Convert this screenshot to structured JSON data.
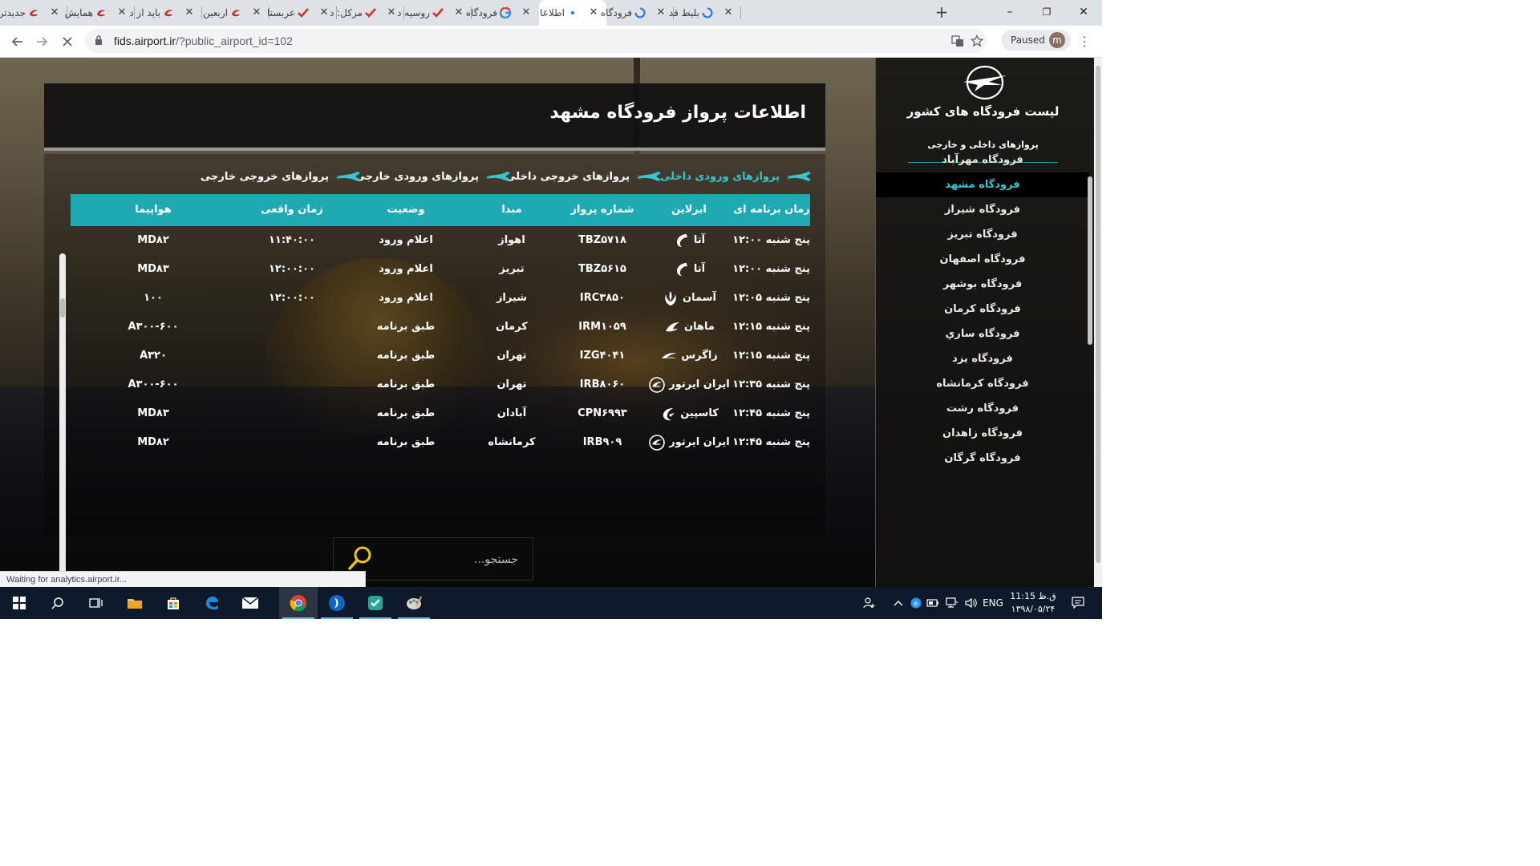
{
  "browser": {
    "tabs": [
      {
        "title": "جدیدتر",
        "favicon": "red-logo-icon",
        "active": false
      },
      {
        "title": "همایش",
        "favicon": "red-logo-icon",
        "active": false
      },
      {
        "title": "باید از د",
        "favicon": "red-logo-icon",
        "active": false
      },
      {
        "title": "اربعین",
        "favicon": "red-logo-icon",
        "active": false
      },
      {
        "title": "عربستا",
        "favicon": "red-check-icon",
        "active": false
      },
      {
        "title": "مرکل: د",
        "favicon": "red-check-icon",
        "active": false
      },
      {
        "title": "روسیه د",
        "favicon": "red-check-icon",
        "active": false
      },
      {
        "title": "فرودگاه",
        "favicon": "google-icon",
        "active": false
      },
      {
        "title": "اطلاعا",
        "favicon": "loading-dot-icon",
        "active": true
      },
      {
        "title": "فرودگاه",
        "favicon": "loading-spinner-icon",
        "active": false
      },
      {
        "title": "بلیط قد",
        "favicon": "loading-spinner-icon",
        "active": false
      }
    ],
    "new_tab_label": "+",
    "window_controls": {
      "minimize": "–",
      "maximize": "❐",
      "close": "✕"
    },
    "url_host": "fids.airport.ir",
    "url_path": "/?public_airport_id=102",
    "profile_status": "Paused",
    "profile_initial": "m",
    "status_text": "Waiting for analytics.airport.ir..."
  },
  "page": {
    "title": "اطلاعات پرواز فرودگاه مشهد",
    "accent_color": "#1ea9b3",
    "active_color": "#36c6d0",
    "filter_tabs": [
      {
        "label": "پروازهای ورودی داخلی",
        "active": true
      },
      {
        "label": "پروازهای خروجی داخلی",
        "active": false
      },
      {
        "label": "پروازهای ورودی خارجی",
        "active": false
      },
      {
        "label": "پروازهای خروجی خارجی",
        "active": false
      }
    ],
    "table": {
      "headers": {
        "scheduled": "زمان برنامه ای",
        "airline": "ایرلاین",
        "flight_no": "شماره پرواز",
        "origin": "مبدا",
        "status": "وضعیت",
        "actual": "زمان واقعی",
        "aircraft": "هواپیما"
      },
      "rows": [
        {
          "scheduled": "پنج شنبه ۱۲:۰۰",
          "airline": "آتا",
          "logo": "ata-airline-logo",
          "flight_no": "TBZ۵۷۱۸",
          "origin": "اهواز",
          "status": "اعلام ورود",
          "actual": "۱۱:۴۰:۰۰",
          "aircraft": "MD۸۲"
        },
        {
          "scheduled": "پنج شنبه ۱۲:۰۰",
          "airline": "آتا",
          "logo": "ata-airline-logo",
          "flight_no": "TBZ۵۶۱۵",
          "origin": "تبریز",
          "status": "اعلام ورود",
          "actual": "۱۲:۰۰:۰۰",
          "aircraft": "MD۸۳"
        },
        {
          "scheduled": "پنج شنبه ۱۲:۰۵",
          "airline": "آسمان",
          "logo": "aseman-airline-logo",
          "flight_no": "IRC۳۸۵۰",
          "origin": "شیراز",
          "status": "اعلام ورود",
          "actual": "۱۲:۰۰:۰۰",
          "aircraft": "۱۰۰"
        },
        {
          "scheduled": "پنج شنبه ۱۲:۱۵",
          "airline": "ماهان",
          "logo": "mahan-airline-logo",
          "flight_no": "IRM۱۰۵۹",
          "origin": "کرمان",
          "status": "طبق برنامه",
          "actual": "",
          "aircraft": "A۳۰۰-۶۰۰"
        },
        {
          "scheduled": "پنج شنبه ۱۲:۱۵",
          "airline": "زاگرس",
          "logo": "zagros-airline-logo",
          "flight_no": "IZG۴۰۴۱",
          "origin": "تهران",
          "status": "طبق برنامه",
          "actual": "",
          "aircraft": "A۳۲۰"
        },
        {
          "scheduled": "پنج شنبه ۱۲:۳۵",
          "airline": "ایران ایرتور",
          "logo": "iran-airtour-logo",
          "flight_no": "IRB۸۰۶۰",
          "origin": "تهران",
          "status": "طبق برنامه",
          "actual": "",
          "aircraft": "A۳۰۰-۶۰۰"
        },
        {
          "scheduled": "پنج شنبه ۱۲:۴۵",
          "airline": "کاسپین",
          "logo": "caspian-airline-logo",
          "flight_no": "CPN۶۹۹۳",
          "origin": "آبادان",
          "status": "طبق برنامه",
          "actual": "",
          "aircraft": "MD۸۳"
        },
        {
          "scheduled": "پنج شنبه ۱۲:۴۵",
          "airline": "ایران ایرتور",
          "logo": "iran-airtour-logo",
          "flight_no": "IRB۹۰۹",
          "origin": "کرمانشاه",
          "status": "طبق برنامه",
          "actual": "",
          "aircraft": "MD۸۲"
        }
      ]
    },
    "search_placeholder": "جستجو..."
  },
  "sidebar": {
    "title": "لیست فرودگاه های کشور",
    "subtitle": "پروازهای داخلی و خارجی",
    "items": [
      {
        "label": "فرودگاه مهرآباد",
        "active": false
      },
      {
        "label": "فرودگاه مشهد",
        "active": true
      },
      {
        "label": "فرودگاه شیراز",
        "active": false
      },
      {
        "label": "فرودگاه تبریز",
        "active": false
      },
      {
        "label": "فرودگاه اصفهان",
        "active": false
      },
      {
        "label": "فرودگاه بوشهر",
        "active": false
      },
      {
        "label": "فرودگاه کرمان",
        "active": false
      },
      {
        "label": "فرودگاه ساري",
        "active": false
      },
      {
        "label": "فرودگاه یزد",
        "active": false
      },
      {
        "label": "فرودگاه کرمانشاه",
        "active": false
      },
      {
        "label": "فرودگاه رشت",
        "active": false
      },
      {
        "label": "فرودگاه زاهدان",
        "active": false
      },
      {
        "label": "فرودگاه گرگان",
        "active": false
      }
    ]
  },
  "taskbar": {
    "apps": [
      "windows-start-icon",
      "search-icon",
      "task-view-icon",
      "file-explorer-icon",
      "store-icon",
      "edge-icon",
      "mail-icon",
      "chrome-icon",
      "app-blue-icon",
      "app-check-icon",
      "paint-icon"
    ],
    "language": "ENG",
    "time": "ق.ظ 11:15",
    "date": "۱۳۹۸/۰۵/۲۴"
  }
}
